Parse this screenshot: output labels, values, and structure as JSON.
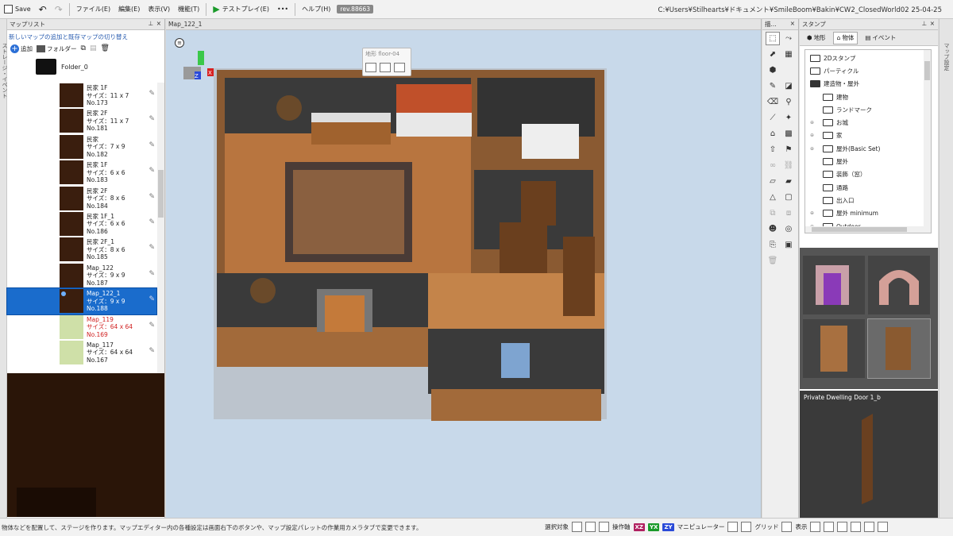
{
  "toolbar": {
    "save_label": "Save",
    "menus": [
      "ファイル(E)",
      "編集(E)",
      "表示(V)",
      "機能(T)"
    ],
    "testplay_label": "テストプレイ(E)",
    "more_label": "•••",
    "help_label": "ヘルプ(H)",
    "revision": "rev.88663",
    "path": "C:¥Users¥Stilhearts¥ドキュメント¥SmileBoom¥Bakin¥CW2_ClosedWorld02 25-04-25"
  },
  "left_strip": {
    "text": "ストレージ・イベント"
  },
  "right_strip": {
    "text": "マップ設定"
  },
  "map_list": {
    "title": "マップリスト",
    "link": "新しいマップの追加と既存マップの切り替え",
    "add_label": "追加",
    "folder_label": "フォルダー",
    "folder_name": "Folder_0",
    "items": [
      {
        "name": "民家 1F",
        "size": "サイズ：11 x 7",
        "no": "No.173"
      },
      {
        "name": "民家 2F",
        "size": "サイズ：11 x 7",
        "no": "No.181"
      },
      {
        "name": "民家",
        "size": "サイズ：7 x 9",
        "no": "No.182"
      },
      {
        "name": "民家 1F",
        "size": "サイズ：6 x 6",
        "no": "No.183"
      },
      {
        "name": "民家 2F",
        "size": "サイズ：8 x 6",
        "no": "No.184"
      },
      {
        "name": "民家 1F_1",
        "size": "サイズ：6 x 6",
        "no": "No.186"
      },
      {
        "name": "民家 2F_1",
        "size": "サイズ：8 x 6",
        "no": "No.185"
      },
      {
        "name": "Map_122",
        "size": "サイズ：9 x 9",
        "no": "No.187"
      },
      {
        "name": "Map_122_1",
        "size": "サイズ：9 x 9",
        "no": "No.188"
      },
      {
        "name": "Map_119",
        "size": "サイズ：64 x 64",
        "no": "No.169"
      },
      {
        "name": "Map_117",
        "size": "サイズ：64 x 64",
        "no": "No.167"
      }
    ]
  },
  "viewport": {
    "title": "Map_122_1",
    "menu_icon": "≡",
    "tooltip_title": "地形 floor-04",
    "gizmo_z": "Z",
    "gizmo_x": "X"
  },
  "tools": {
    "title": "描..."
  },
  "stamp": {
    "title": "スタンプ",
    "tabs": [
      "地形",
      "物体",
      "イベント"
    ],
    "tree": [
      {
        "label": "2Dスタンプ",
        "depth": 0,
        "plus": false,
        "open": false
      },
      {
        "label": "パーティクル",
        "depth": 0,
        "plus": false,
        "open": false
      },
      {
        "label": "建造物・屋外",
        "depth": 0,
        "plus": false,
        "open": true
      },
      {
        "label": "建物",
        "depth": 1,
        "plus": false,
        "open": false
      },
      {
        "label": "ランドマーク",
        "depth": 1,
        "plus": false,
        "open": false
      },
      {
        "label": "お城",
        "depth": 1,
        "plus": true,
        "open": false
      },
      {
        "label": "家",
        "depth": 1,
        "plus": true,
        "open": false
      },
      {
        "label": "屋外(Basic Set)",
        "depth": 1,
        "plus": true,
        "open": false
      },
      {
        "label": "屋外",
        "depth": 1,
        "plus": false,
        "open": false
      },
      {
        "label": "装飾（窓）",
        "depth": 1,
        "plus": false,
        "open": false
      },
      {
        "label": "通路",
        "depth": 1,
        "plus": false,
        "open": false
      },
      {
        "label": "出入口",
        "depth": 1,
        "plus": false,
        "open": false
      },
      {
        "label": "屋外 minimum",
        "depth": 1,
        "plus": true,
        "open": false
      },
      {
        "label": "Outdoor",
        "depth": 1,
        "plus": true,
        "open": false
      }
    ],
    "selected_name": "Private Dwelling Door 1_b"
  },
  "status": {
    "message": "物体などを配置して、ステージを作ります。マップエディター内の各種設定は画面右下のボタンや、マップ設定パレットの作業用カメラタブで変更できます。",
    "select_label": "選択対象",
    "op_label": "操作軸",
    "axis_xz": "XZ",
    "axis_yx": "YX",
    "axis_zy": "ZY",
    "manip_label": "マニピュレーター",
    "grid_label": "グリッド",
    "display_label": "表示"
  },
  "colors": {
    "selection": "#1a6ccc",
    "accent_blue": "#2b6fd6",
    "sky": "#c8d9ea",
    "red_item": "#d02020"
  }
}
